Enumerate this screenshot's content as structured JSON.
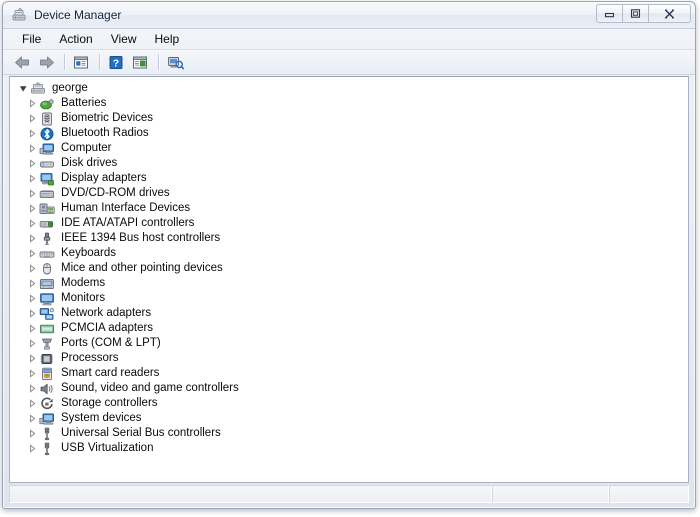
{
  "window": {
    "title": "Device Manager",
    "icon": "device-manager-icon",
    "controls": [
      {
        "name": "minimize-button",
        "glyph": "minimize"
      },
      {
        "name": "maximize-button",
        "glyph": "maximize"
      },
      {
        "name": "close-button",
        "glyph": "close"
      }
    ]
  },
  "menubar": {
    "items": [
      {
        "label": "File"
      },
      {
        "label": "Action"
      },
      {
        "label": "View"
      },
      {
        "label": "Help"
      }
    ]
  },
  "toolbar": {
    "buttons": [
      {
        "name": "back-button",
        "icon": "back-arrow-icon",
        "title": "Back"
      },
      {
        "name": "forward-button",
        "icon": "forward-arrow-icon",
        "title": "Forward"
      },
      {
        "name": "properties-button",
        "icon": "properties-icon",
        "title": "Properties"
      },
      {
        "name": "help-button",
        "icon": "help-question-icon",
        "title": "Help"
      },
      {
        "name": "show-hidden-button",
        "icon": "show-hidden-icon",
        "title": "Show hidden devices"
      },
      {
        "name": "scan-hardware-button",
        "icon": "scan-hardware-icon",
        "title": "Scan for hardware changes"
      }
    ]
  },
  "tree": {
    "root": {
      "label": "george",
      "icon": "computer-root-icon",
      "expanded": true
    },
    "items": [
      {
        "label": "Batteries",
        "icon": "battery-icon"
      },
      {
        "label": "Biometric Devices",
        "icon": "biometric-icon"
      },
      {
        "label": "Bluetooth Radios",
        "icon": "bluetooth-icon"
      },
      {
        "label": "Computer",
        "icon": "computer-icon"
      },
      {
        "label": "Disk drives",
        "icon": "disk-drive-icon"
      },
      {
        "label": "Display adapters",
        "icon": "display-adapter-icon"
      },
      {
        "label": "DVD/CD-ROM drives",
        "icon": "dvd-drive-icon"
      },
      {
        "label": "Human Interface Devices",
        "icon": "hid-icon"
      },
      {
        "label": "IDE ATA/ATAPI controllers",
        "icon": "ide-controller-icon"
      },
      {
        "label": "IEEE 1394 Bus host controllers",
        "icon": "ieee1394-icon"
      },
      {
        "label": "Keyboards",
        "icon": "keyboard-icon"
      },
      {
        "label": "Mice and other pointing devices",
        "icon": "mouse-icon"
      },
      {
        "label": "Modems",
        "icon": "modem-icon"
      },
      {
        "label": "Monitors",
        "icon": "monitor-icon"
      },
      {
        "label": "Network adapters",
        "icon": "network-adapter-icon"
      },
      {
        "label": "PCMCIA adapters",
        "icon": "pcmcia-icon"
      },
      {
        "label": "Ports (COM & LPT)",
        "icon": "port-icon"
      },
      {
        "label": "Processors",
        "icon": "processor-icon"
      },
      {
        "label": "Smart card readers",
        "icon": "smartcard-icon"
      },
      {
        "label": "Sound, video and game controllers",
        "icon": "sound-icon"
      },
      {
        "label": "Storage controllers",
        "icon": "storage-controller-icon"
      },
      {
        "label": "System devices",
        "icon": "system-device-icon"
      },
      {
        "label": "Universal Serial Bus controllers",
        "icon": "usb-icon"
      },
      {
        "label": "USB Virtualization",
        "icon": "usb-icon"
      }
    ]
  },
  "statusbar": {
    "panes": [
      {
        "text": ""
      },
      {
        "text": ""
      },
      {
        "text": ""
      }
    ]
  },
  "colors": {
    "window_frame": "#9aa6bb",
    "title_text": "#12223a",
    "content_bg": "#ffffff",
    "accent_blue": "#1b6fc4",
    "battery_green": "#3f9b2f"
  }
}
